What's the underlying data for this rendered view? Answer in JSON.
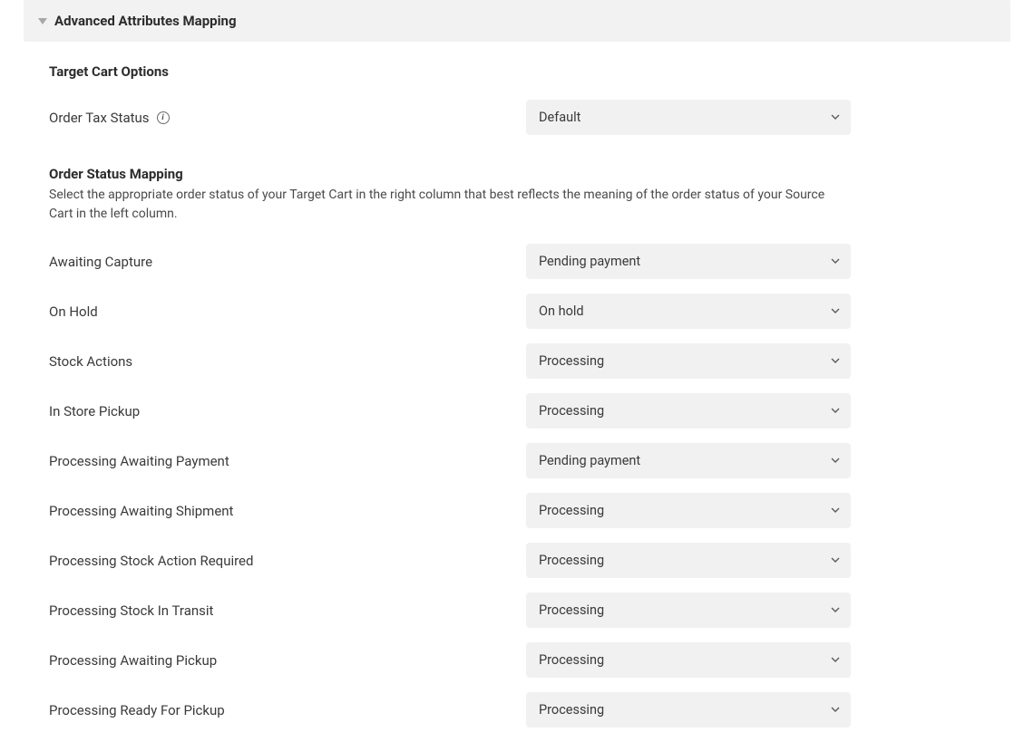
{
  "panel": {
    "title": "Advanced Attributes Mapping"
  },
  "target_cart": {
    "heading": "Target Cart Options",
    "tax_status": {
      "label": "Order Tax Status",
      "value": "Default"
    }
  },
  "order_status_mapping": {
    "heading": "Order Status Mapping",
    "description": "Select the appropriate order status of your Target Cart in the right column that best reflects the meaning of the order status of your Source Cart in the left column.",
    "rows": [
      {
        "label": "Awaiting Capture",
        "value": "Pending payment"
      },
      {
        "label": "On Hold",
        "value": "On hold"
      },
      {
        "label": "Stock Actions",
        "value": "Processing"
      },
      {
        "label": "In Store Pickup",
        "value": "Processing"
      },
      {
        "label": "Processing Awaiting Payment",
        "value": "Pending payment"
      },
      {
        "label": "Processing Awaiting Shipment",
        "value": "Processing"
      },
      {
        "label": "Processing Stock Action Required",
        "value": "Processing"
      },
      {
        "label": "Processing Stock In Transit",
        "value": "Processing"
      },
      {
        "label": "Processing Awaiting Pickup",
        "value": "Processing"
      },
      {
        "label": "Processing Ready For Pickup",
        "value": "Processing"
      }
    ]
  }
}
